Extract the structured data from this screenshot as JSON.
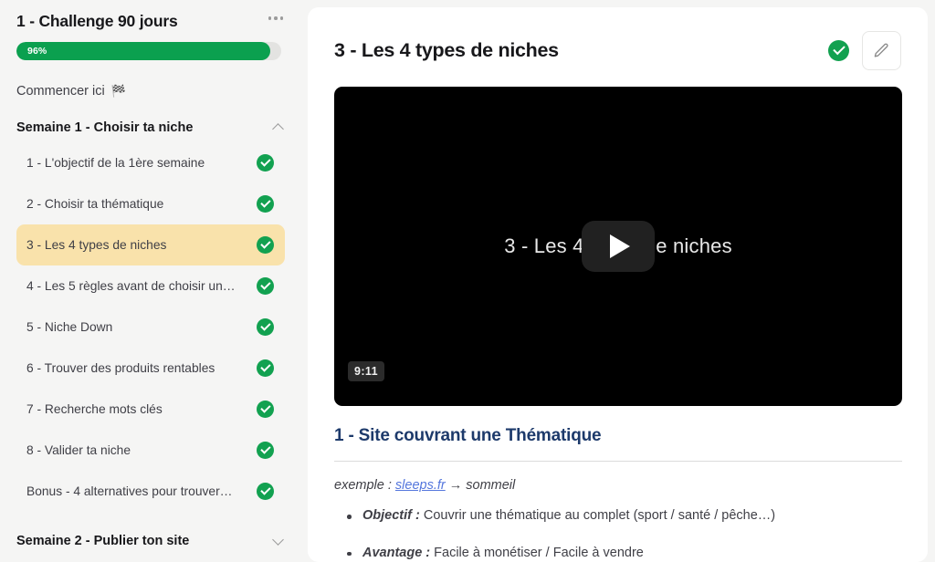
{
  "sidebar": {
    "course_title": "1 - Challenge 90 jours",
    "menu_icon": "ellipsis-horizontal-icon",
    "progress": {
      "value": 96,
      "label": "96%",
      "fill_color": "#0ba04f",
      "track_color": "#e3e3e1"
    },
    "start_here": {
      "label": "Commencer ici",
      "icon": "checkered-flag-icon",
      "glyph": "🏁"
    },
    "sections": [
      {
        "title": "Semaine 1 - Choisir ta niche",
        "expanded": true,
        "chevron": "chevron-up-icon",
        "lessons": [
          {
            "label": "1 - L'objectif de la 1ère semaine",
            "completed": true,
            "active": false
          },
          {
            "label": "2 - Choisir ta thématique",
            "completed": true,
            "active": false
          },
          {
            "label": "3 - Les 4 types de niches",
            "completed": true,
            "active": true
          },
          {
            "label": "4 - Les 5 règles avant de choisir un…",
            "completed": true,
            "active": false
          },
          {
            "label": "5 - Niche Down",
            "completed": true,
            "active": false
          },
          {
            "label": "6 - Trouver des produits rentables",
            "completed": true,
            "active": false
          },
          {
            "label": "7 - Recherche mots clés",
            "completed": true,
            "active": false
          },
          {
            "label": "8 - Valider ta niche",
            "completed": true,
            "active": false
          },
          {
            "label": "Bonus - 4 alternatives pour trouver…",
            "completed": true,
            "active": false
          }
        ]
      },
      {
        "title": "Semaine 2 - Publier ton site",
        "expanded": false,
        "chevron": "chevron-down-icon",
        "lessons": []
      }
    ]
  },
  "main": {
    "lesson_title": "3 - Les 4 types de niches",
    "completed_icon": "check-circle-icon",
    "edit_icon": "pencil-icon",
    "video": {
      "overlay_title": "3 - Les 4 types de niches",
      "play_icon": "play-button-icon",
      "duration": "9:11",
      "background": "#000000"
    },
    "content": {
      "heading": "1 - Site couvrant une Thématique",
      "example_prefix": "exemple : ",
      "example_link": "sleeps.fr",
      "example_suffix": " → sommeil",
      "bullets": [
        {
          "term": "Objectif :",
          "text": " Couvrir une thématique au complet (sport / santé / pêche…)"
        },
        {
          "term": "Avantage :",
          "text": " Facile à monétiser / Facile à vendre"
        }
      ]
    }
  }
}
